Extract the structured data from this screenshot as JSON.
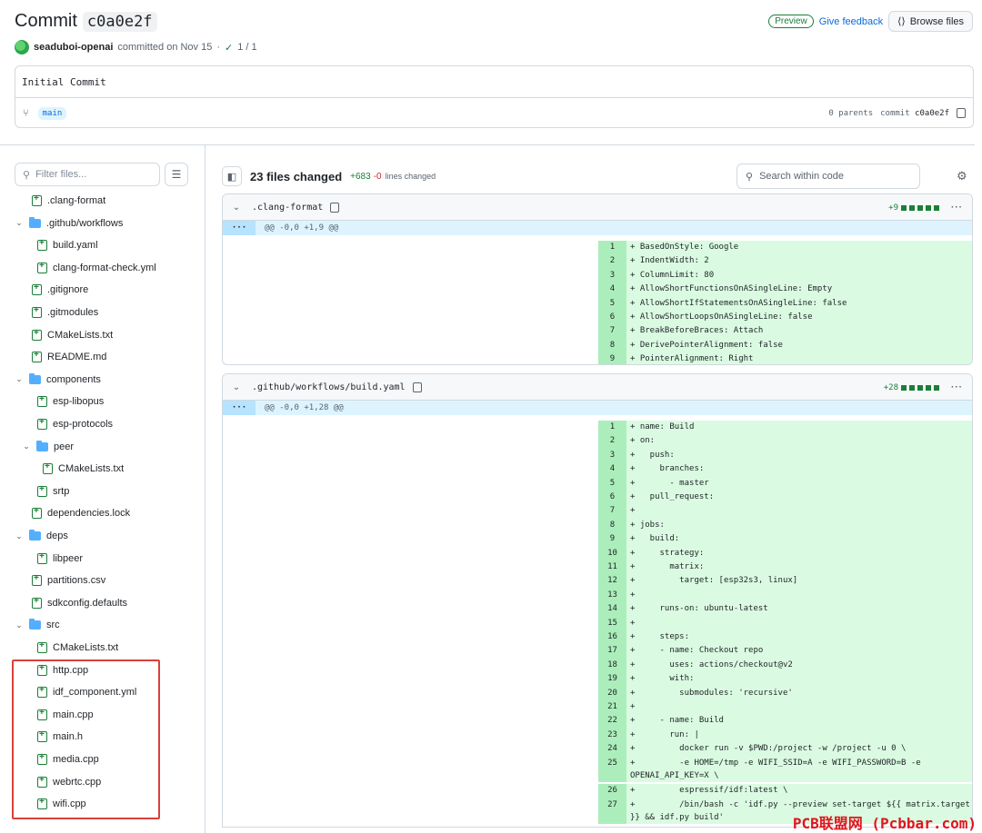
{
  "header": {
    "title": "Commit",
    "sha": "c0a0e2f",
    "author": "seaduboi-openai",
    "committed_text": "committed on Nov 15",
    "separator": "·",
    "checks": "1 / 1",
    "preview_badge": "Preview",
    "feedback_link": "Give feedback",
    "browse_button": "Browse files"
  },
  "commit": {
    "message": "Initial Commit",
    "branch": "main",
    "parents": "0 parents",
    "commit_label": "commit",
    "commit_sha": "c0a0e2f"
  },
  "sidebar": {
    "filter_placeholder": "Filter files...",
    "tree": [
      {
        "label": ".clang-format",
        "type": "file",
        "depth": 1
      },
      {
        "label": ".github/workflows",
        "type": "folder",
        "depth": 0
      },
      {
        "label": "build.yaml",
        "type": "file",
        "depth": 2
      },
      {
        "label": "clang-format-check.yml",
        "type": "file",
        "depth": 2
      },
      {
        "label": ".gitignore",
        "type": "file",
        "depth": 1
      },
      {
        "label": ".gitmodules",
        "type": "file",
        "depth": 1
      },
      {
        "label": "CMakeLists.txt",
        "type": "file",
        "depth": 1
      },
      {
        "label": "README.md",
        "type": "file",
        "depth": 1
      },
      {
        "label": "components",
        "type": "folder",
        "depth": 0
      },
      {
        "label": "esp-libopus",
        "type": "file",
        "depth": 2
      },
      {
        "label": "esp-protocols",
        "type": "file",
        "depth": 2
      },
      {
        "label": "peer",
        "type": "folder",
        "depth": 1
      },
      {
        "label": "CMakeLists.txt",
        "type": "file",
        "depth": 3
      },
      {
        "label": "srtp",
        "type": "file",
        "depth": 2
      },
      {
        "label": "dependencies.lock",
        "type": "file",
        "depth": 1
      },
      {
        "label": "deps",
        "type": "folder",
        "depth": 0
      },
      {
        "label": "libpeer",
        "type": "file",
        "depth": 2
      },
      {
        "label": "partitions.csv",
        "type": "file",
        "depth": 1
      },
      {
        "label": "sdkconfig.defaults",
        "type": "file",
        "depth": 1
      },
      {
        "label": "src",
        "type": "folder",
        "depth": 0
      },
      {
        "label": "CMakeLists.txt",
        "type": "file",
        "depth": 2
      },
      {
        "label": "http.cpp",
        "type": "file",
        "depth": 2
      },
      {
        "label": "idf_component.yml",
        "type": "file",
        "depth": 2
      },
      {
        "label": "main.cpp",
        "type": "file",
        "depth": 2
      },
      {
        "label": "main.h",
        "type": "file",
        "depth": 2
      },
      {
        "label": "media.cpp",
        "type": "file",
        "depth": 2
      },
      {
        "label": "webrtc.cpp",
        "type": "file",
        "depth": 2
      },
      {
        "label": "wifi.cpp",
        "type": "file",
        "depth": 2
      }
    ]
  },
  "toolbar": {
    "files_changed": "23 files changed",
    "additions": "+683",
    "deletions": "-0",
    "lines_changed": "lines changed",
    "search_placeholder": "Search within code"
  },
  "files": [
    {
      "name": ".clang-format",
      "stat": "+9",
      "hunk": "@@ -0,0 +1,9 @@",
      "lines": [
        "+ BasedOnStyle: Google",
        "+ IndentWidth: 2",
        "+ ColumnLimit: 80",
        "+ AllowShortFunctionsOnASingleLine: Empty",
        "+ AllowShortIfStatementsOnASingleLine: false",
        "+ AllowShortLoopsOnASingleLine: false",
        "+ BreakBeforeBraces: Attach",
        "+ DerivePointerAlignment: false",
        "+ PointerAlignment: Right"
      ]
    },
    {
      "name": ".github/workflows/build.yaml",
      "stat": "+28",
      "hunk": "@@ -0,0 +1,28 @@",
      "lines": [
        "+ name: Build",
        "+ on:",
        "+   push:",
        "+     branches:",
        "+       - master",
        "+   pull_request:",
        "+",
        "+ jobs:",
        "+   build:",
        "+     strategy:",
        "+       matrix:",
        "+         target: [esp32s3, linux]",
        "+",
        "+     runs-on: ubuntu-latest",
        "+",
        "+     steps:",
        "+     - name: Checkout repo",
        "+       uses: actions/checkout@v2",
        "+       with:",
        "+         submodules: 'recursive'",
        "+",
        "+     - name: Build",
        "+       run: |",
        "+         docker run -v $PWD:/project -w /project -u 0 \\",
        "+         -e HOME=/tmp -e WIFI_SSID=A -e WIFI_PASSWORD=B -e OPENAI_API_KEY=X \\",
        "+         espressif/idf:latest \\",
        "+         /bin/bash -c 'idf.py --preview set-target ${{ matrix.target }} && idf.py build'"
      ]
    }
  ],
  "watermark": "PCB联盟网 (Pcbbar.com)"
}
